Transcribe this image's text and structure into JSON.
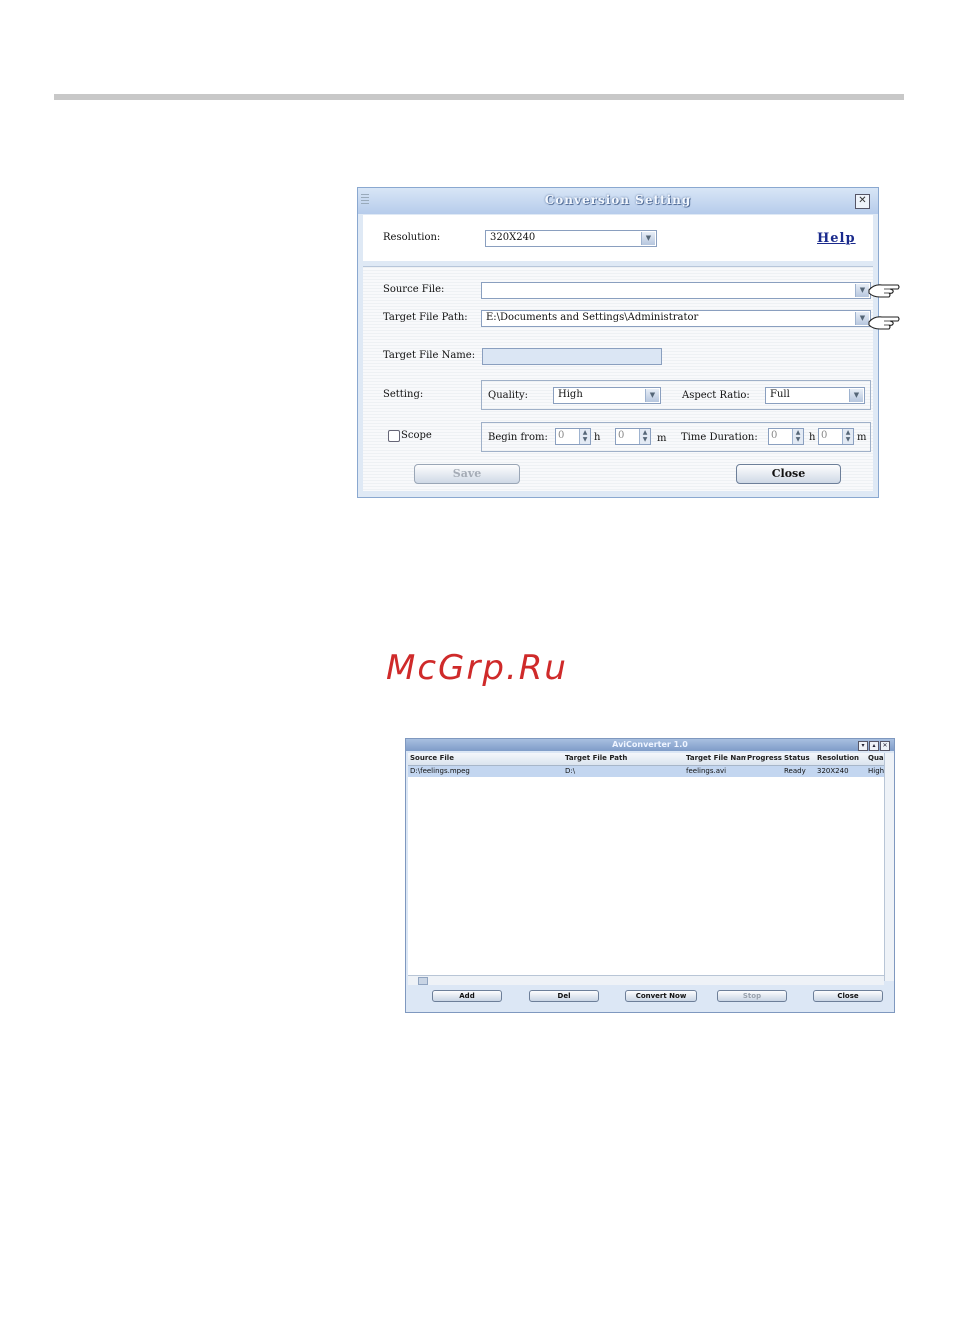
{
  "dialog": {
    "title": "Conversion Setting",
    "resolution_label": "Resolution:",
    "resolution_value": "320X240",
    "help_label": "Help",
    "source_file_label": "Source File:",
    "source_file_value": "",
    "target_path_label": "Target File Path:",
    "target_path_value": "E:\\Documents and Settings\\Administrator",
    "target_name_label": "Target File Name:",
    "target_name_value": "",
    "setting_label": "Setting:",
    "quality_label": "Quality:",
    "quality_value": "High",
    "aspect_label": "Aspect Ratio:",
    "aspect_value": "Full",
    "scope_label": "Scope",
    "scope_checked": false,
    "begin_label": "Begin from:",
    "begin_h": "0",
    "h_unit": "h",
    "begin_m": "0",
    "m_unit": "m",
    "duration_label": "Time Duration:",
    "duration_h": "0",
    "duration_m": "0",
    "save_label": "Save",
    "close_label": "Close"
  },
  "watermark": "McGrp.Ru",
  "app": {
    "title": "AviConverter 1.0",
    "columns": [
      "Source File",
      "Target File Path",
      "Target File Name",
      "Progress",
      "Status",
      "Resolution",
      "Qual"
    ],
    "rows": [
      [
        "D:\\feelings.mpeg",
        "D:\\",
        "feelings.avi",
        "",
        "Ready",
        "320X240",
        "High"
      ]
    ],
    "buttons": {
      "add": "Add",
      "del": "Del",
      "convert": "Convert Now",
      "stop": "Stop",
      "close": "Close"
    }
  }
}
